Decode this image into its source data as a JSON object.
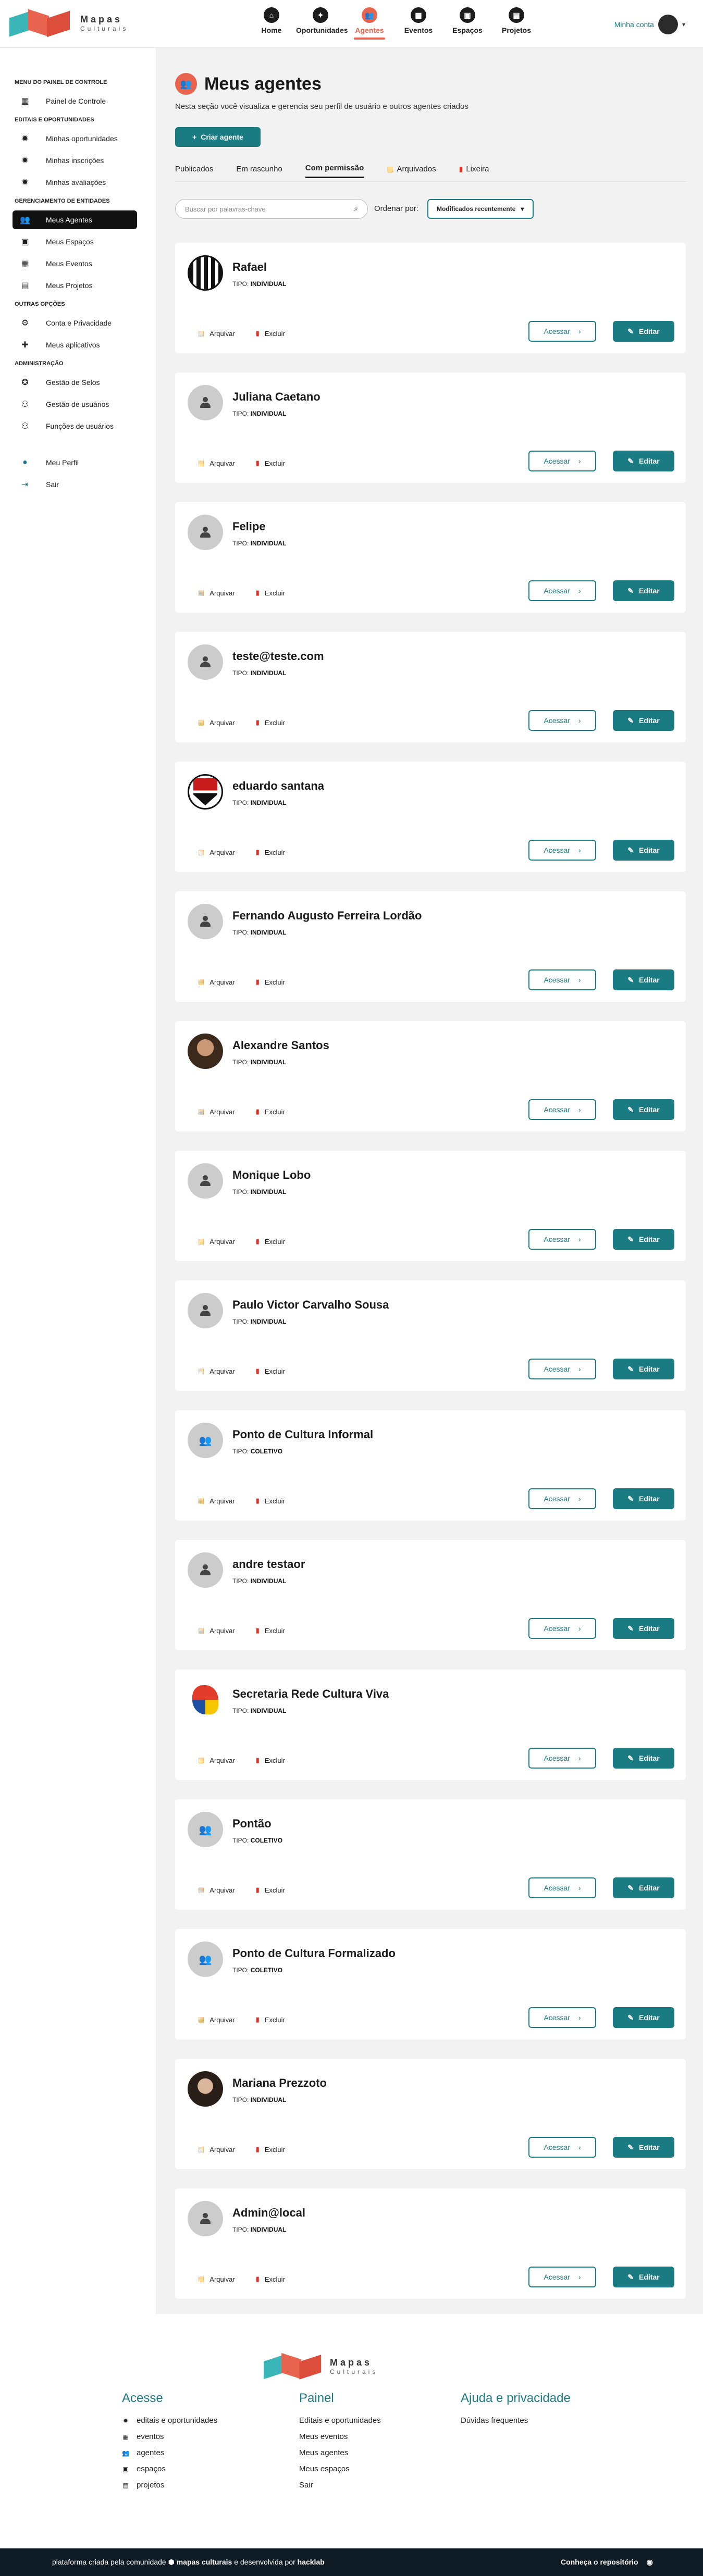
{
  "brand": {
    "line1": "Mapas",
    "line2": "Culturais"
  },
  "topnav": [
    {
      "label": "Home",
      "icon": "home-icon",
      "glyph": "⌂",
      "active": false
    },
    {
      "label": "Oportunidades",
      "icon": "lightbulb-icon",
      "glyph": "✦",
      "active": false
    },
    {
      "label": "Agentes",
      "icon": "people-icon",
      "glyph": "👥",
      "active": true
    },
    {
      "label": "Eventos",
      "icon": "calendar-icon",
      "glyph": "▦",
      "active": false
    },
    {
      "label": "Espaços",
      "icon": "building-icon",
      "glyph": "▣",
      "active": false
    },
    {
      "label": "Projetos",
      "icon": "clipboard-icon",
      "glyph": "▤",
      "active": false
    }
  ],
  "account": {
    "label": "Minha conta"
  },
  "sidebar": {
    "sections": [
      {
        "title": "MENU DO PAINEL DE CONTROLE",
        "items": [
          {
            "label": "Painel de Controle",
            "glyph": "▦",
            "icon": "dashboard-icon"
          }
        ]
      },
      {
        "title": "EDITAIS E OPORTUNIDADES",
        "items": [
          {
            "label": "Minhas oportunidades",
            "glyph": "✹",
            "icon": "lightbulb-icon"
          },
          {
            "label": "Minhas inscrições",
            "glyph": "✹",
            "icon": "lightbulb-icon"
          },
          {
            "label": "Minhas avaliações",
            "glyph": "✹",
            "icon": "lightbulb-icon"
          }
        ]
      },
      {
        "title": "GERENCIAMENTO DE ENTIDADES",
        "items": [
          {
            "label": "Meus Agentes",
            "glyph": "👥",
            "icon": "people-icon",
            "active": true
          },
          {
            "label": "Meus Espaços",
            "glyph": "▣",
            "icon": "building-icon"
          },
          {
            "label": "Meus Eventos",
            "glyph": "▦",
            "icon": "calendar-icon"
          },
          {
            "label": "Meus Projetos",
            "glyph": "▤",
            "icon": "clipboard-icon"
          }
        ]
      },
      {
        "title": "OUTRAS OPÇÕES",
        "items": [
          {
            "label": "Conta e Privacidade",
            "glyph": "⚙",
            "icon": "gear-icon"
          },
          {
            "label": "Meus aplicativos",
            "glyph": "✚",
            "icon": "puzzle-icon"
          }
        ]
      },
      {
        "title": "ADMINISTRAÇÃO",
        "items": [
          {
            "label": "Gestão de Selos",
            "glyph": "✪",
            "icon": "seal-icon"
          },
          {
            "label": "Gestão de usuários",
            "glyph": "⚇",
            "icon": "users-gear-icon"
          },
          {
            "label": "Funções de usuários",
            "glyph": "⚇",
            "icon": "user-roles-icon"
          }
        ]
      },
      {
        "title": "",
        "items": [
          {
            "label": "Meu Perfil",
            "glyph": "●",
            "icon": "profile-icon",
            "teal": true
          },
          {
            "label": "Sair",
            "glyph": "⇥",
            "icon": "logout-icon",
            "teal": true
          }
        ]
      }
    ]
  },
  "main": {
    "title": "Meus agentes",
    "description": "Nesta seção você visualiza e gerencia seu perfil de usuário e outros agentes criados",
    "create_label": "Criar agente",
    "tabs": [
      {
        "label": "Publicados"
      },
      {
        "label": "Em rascunho"
      },
      {
        "label": "Com permissão",
        "active": true
      },
      {
        "label": "Arquivados",
        "icon": "archive-icon"
      },
      {
        "label": "Lixeira",
        "icon": "trash-icon"
      }
    ],
    "search_placeholder": "Buscar por palavras-chave",
    "sort_label": "Ordenar por:",
    "sort_value": "Modificados recentemente",
    "type_prefix": "TIPO:",
    "archive_label": "Arquivar",
    "delete_label": "Excluir",
    "access_label": "Acessar",
    "edit_label": "Editar"
  },
  "agents": [
    {
      "name": "Rafael",
      "type": "INDIVIDUAL",
      "avatar": "img-striped"
    },
    {
      "name": "Juliana Caetano",
      "type": "INDIVIDUAL",
      "avatar": "person"
    },
    {
      "name": "Felipe",
      "type": "INDIVIDUAL",
      "avatar": "person"
    },
    {
      "name": "teste@teste.com",
      "type": "INDIVIDUAL",
      "avatar": "person"
    },
    {
      "name": "eduardo santana",
      "type": "INDIVIDUAL",
      "avatar": "img-spfc"
    },
    {
      "name": "Fernando Augusto Ferreira Lordão",
      "type": "INDIVIDUAL",
      "avatar": "person"
    },
    {
      "name": "Alexandre Santos",
      "type": "INDIVIDUAL",
      "avatar": "img-photo1"
    },
    {
      "name": "Monique Lobo",
      "type": "INDIVIDUAL",
      "avatar": "person"
    },
    {
      "name": "Paulo Victor Carvalho Sousa",
      "type": "INDIVIDUAL",
      "avatar": "person"
    },
    {
      "name": "Ponto de Cultura Informal",
      "type": "COLETIVO",
      "avatar": "group"
    },
    {
      "name": "andre testaor",
      "type": "INDIVIDUAL",
      "avatar": "person"
    },
    {
      "name": "Secretaria Rede Cultura Viva",
      "type": "INDIVIDUAL",
      "avatar": "img-logo"
    },
    {
      "name": "Pontão",
      "type": "COLETIVO",
      "avatar": "group"
    },
    {
      "name": "Ponto de Cultura Formalizado",
      "type": "COLETIVO",
      "avatar": "group"
    },
    {
      "name": "Mariana Prezzoto",
      "type": "INDIVIDUAL",
      "avatar": "img-photo2"
    },
    {
      "name": "Admin@local",
      "type": "INDIVIDUAL",
      "avatar": "person"
    }
  ],
  "footer": {
    "columns": [
      {
        "title": "Acesse",
        "links": [
          {
            "label": "editais e oportunidades",
            "glyph": "✹",
            "icon": "lightbulb-icon"
          },
          {
            "label": "eventos",
            "glyph": "▦",
            "icon": "calendar-icon"
          },
          {
            "label": "agentes",
            "glyph": "👥",
            "icon": "people-icon"
          },
          {
            "label": "espaços",
            "glyph": "▣",
            "icon": "building-icon"
          },
          {
            "label": "projetos",
            "glyph": "▤",
            "icon": "clipboard-icon"
          }
        ]
      },
      {
        "title": "Painel",
        "links": [
          {
            "label": "Editais e oportunidades"
          },
          {
            "label": "Meus eventos"
          },
          {
            "label": "Meus agentes"
          },
          {
            "label": "Meus espaços"
          },
          {
            "label": "Sair"
          }
        ]
      },
      {
        "title": "Ajuda e privacidade",
        "links": [
          {
            "label": "Dúvidas frequentes"
          }
        ]
      }
    ],
    "bottom_text_1": "plataforma criada pela comunidade",
    "bottom_brand_1": "mapas culturais",
    "bottom_text_2": "e desenvolvida por",
    "bottom_brand_2": "hacklab",
    "repo_label": "Conheça o repositório"
  }
}
